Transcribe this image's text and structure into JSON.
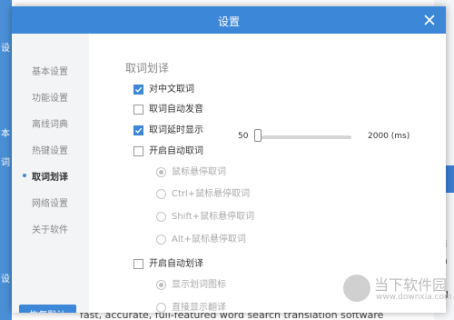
{
  "background": {
    "left_glyphs": [
      "设",
      "本",
      "词",
      "设"
    ],
    "right_glyphs": [
      "鼠",
      "s i",
      "ca",
      "ar",
      "ng",
      "ta"
    ],
    "bottom_text": "fast, accurate, full-featured word search translation software"
  },
  "dialog": {
    "title": "设置",
    "accent_color": "#3d87d8"
  },
  "sidebar": {
    "items": [
      {
        "label": "基本设置",
        "active": false
      },
      {
        "label": "功能设置",
        "active": false
      },
      {
        "label": "离线词典",
        "active": false
      },
      {
        "label": "热键设置",
        "active": false
      },
      {
        "label": "取词划译",
        "active": true
      },
      {
        "label": "网络设置",
        "active": false
      },
      {
        "label": "关于软件",
        "active": false
      }
    ],
    "reset_label": "恢复默认"
  },
  "main": {
    "section_title": "取词划译",
    "options": [
      {
        "label": "对中文取词",
        "type": "checkbox",
        "checked": true,
        "disabled": false
      },
      {
        "label": "取词自动发音",
        "type": "checkbox",
        "checked": false,
        "disabled": false
      },
      {
        "label": "取词延时显示",
        "type": "checkbox",
        "checked": true,
        "disabled": false
      },
      {
        "label": "开启自动取词",
        "type": "checkbox",
        "checked": false,
        "disabled": false
      },
      {
        "label": "鼠标悬停取词",
        "type": "radio",
        "checked": true,
        "disabled": true
      },
      {
        "label": "Ctrl+鼠标悬停取词",
        "type": "radio",
        "checked": false,
        "disabled": true
      },
      {
        "label": "Shift+鼠标悬停取词",
        "type": "radio",
        "checked": false,
        "disabled": true
      },
      {
        "label": "Alt+鼠标悬停取词",
        "type": "radio",
        "checked": false,
        "disabled": true
      },
      {
        "label": "开启自动划译",
        "type": "checkbox",
        "checked": false,
        "disabled": false
      },
      {
        "label": "显示划词图标",
        "type": "radio",
        "checked": true,
        "disabled": true
      },
      {
        "label": "直接显示翻译",
        "type": "radio",
        "checked": false,
        "disabled": true
      }
    ],
    "delay_slider": {
      "min_label": "50",
      "max_label": "2000 (ms)",
      "value_fraction": 0.0
    }
  },
  "watermark": {
    "text": "当下软件园",
    "url": "www.downxia.com"
  }
}
